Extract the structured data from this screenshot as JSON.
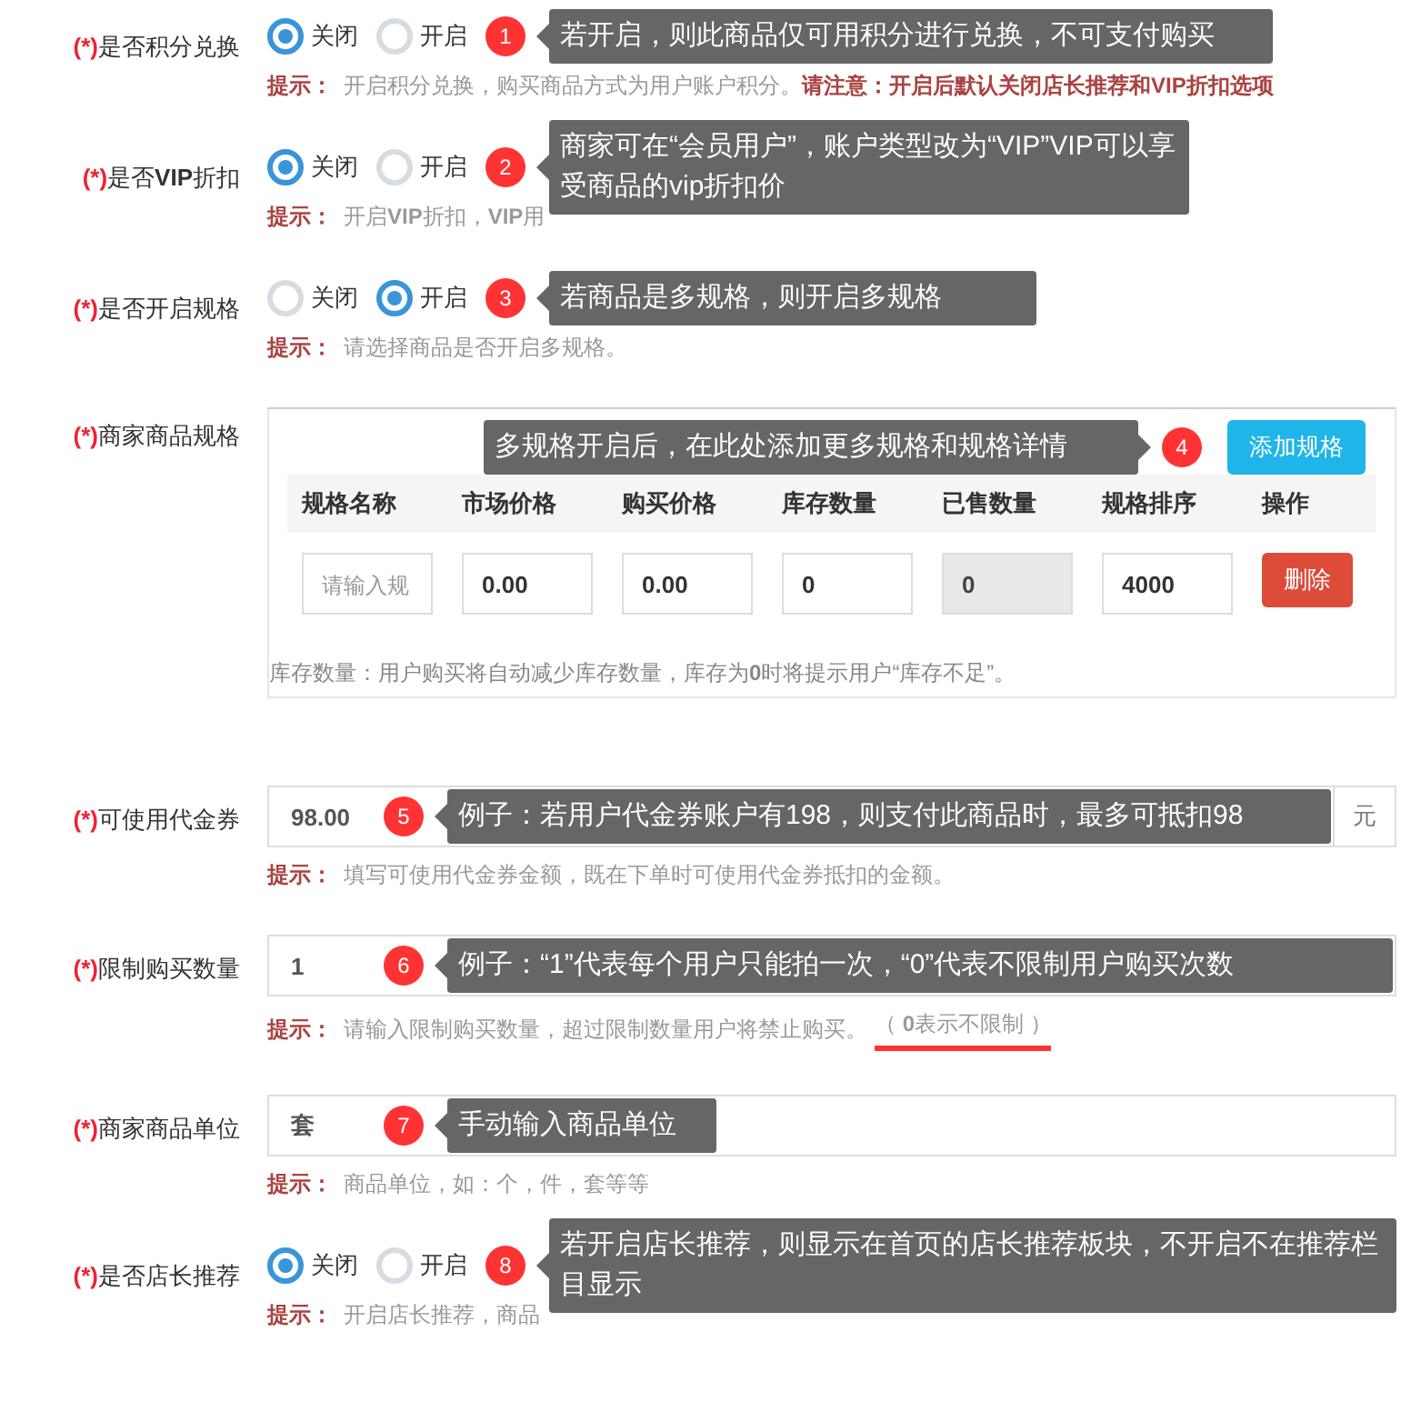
{
  "fields": [
    {
      "kind": "radio",
      "marker": "(*)",
      "label": "是否积分兑换",
      "options": [
        {
          "label": "关闭",
          "selected": true
        },
        {
          "label": "开启",
          "selected": false
        }
      ],
      "callout": {
        "number": "1",
        "text": "若开启，则此商品仅可用积分进行兑换，不可支付购买",
        "badge_first": true
      },
      "hint": {
        "prefix": "提示：",
        "text": "开启积分兑换，购买商品方式为用户账户积分。",
        "warning": "请注意：开启后默认关闭店长推荐和VIP折扣选项"
      }
    },
    {
      "kind": "radio",
      "marker": "(*)",
      "label": "是否**VIP**折扣",
      "options": [
        {
          "label": "关闭",
          "selected": true
        },
        {
          "label": "开启",
          "selected": false
        }
      ],
      "callout": {
        "number": "2",
        "text": "商家可在“会员用户”，账户类型改为“VIP”VIP可以享受商品的vip折扣价",
        "badge_first": true
      },
      "hint": {
        "prefix": "提示：",
        "text": "开启**VIP**折扣，**VIP**用"
      }
    },
    {
      "kind": "radio",
      "marker": "(*)",
      "label": "是否开启规格",
      "options": [
        {
          "label": "关闭",
          "selected": false
        },
        {
          "label": "开启",
          "selected": true
        }
      ],
      "callout": {
        "number": "3",
        "text": "若商品是多规格，则开启多规格",
        "badge_first": true
      },
      "hint": {
        "prefix": "提示：",
        "text": "请选择商品是否开启多规格。"
      }
    },
    {
      "kind": "spec_table",
      "marker": "(*)",
      "label": "商家商品规格",
      "add_button": "添加规格",
      "callout": {
        "number": "4",
        "text": "多规格开启后，在此处添加更多规格和规格详情",
        "badge_first": false
      },
      "columns": [
        "规格名称",
        "市场价格",
        "购买价格",
        "库存数量",
        "已售数量",
        "规格排序",
        "操作"
      ],
      "rows": [
        {
          "cells": [
            {
              "placeholder": "请输入规",
              "disabled": false
            },
            {
              "value": "0.00",
              "disabled": false
            },
            {
              "value": "0.00",
              "disabled": false
            },
            {
              "value": "0",
              "disabled": false
            },
            {
              "value": "0",
              "disabled": true
            },
            {
              "value": "4000",
              "disabled": false
            }
          ],
          "action": "删除"
        }
      ],
      "note": "库存数量：用户购买将自动减少库存数量，库存为**0**时将提示用户“库存不足”。"
    },
    {
      "kind": "input",
      "marker": "(*)",
      "label": "可使用代金券",
      "value": "98.00",
      "addon": "元",
      "callout": {
        "number": "5",
        "text": "例子：若用户代金券账户有198，则支付此商品时，最多可抵扣98",
        "badge_first": true
      },
      "hint": {
        "prefix": "提示：",
        "text": "填写可使用代金券金额，既在下单时可使用代金券抵扣的金额。"
      }
    },
    {
      "kind": "input",
      "marker": "(*)",
      "label": "限制购买数量",
      "value": "1",
      "callout": {
        "number": "6",
        "text": "例子：“1”代表每个用户只能拍一次，“0”代表不限制用户购买次数",
        "badge_first": true
      },
      "hint": {
        "prefix": "提示：",
        "text": "请输入限制购买数量，超过限制数量用户将禁止购买。",
        "note": "（ **0**表示不限制 ）",
        "underlined": true
      }
    },
    {
      "kind": "input",
      "marker": "(*)",
      "label": "商家商品单位",
      "value": "套",
      "callout": {
        "number": "7",
        "text": "手动输入商品单位",
        "badge_first": true
      },
      "hint": {
        "prefix": "提示：",
        "text": "商品单位，如：个，件，套等等"
      }
    },
    {
      "kind": "radio",
      "marker": "(*)",
      "label": "是否店长推荐",
      "options": [
        {
          "label": "关闭",
          "selected": true
        },
        {
          "label": "开启",
          "selected": false
        }
      ],
      "callout": {
        "number": "8",
        "text": "若开启店长推荐，则显示在首页的店长推荐板块，不开启不在推荐栏目显示",
        "badge_first": true
      },
      "hint": {
        "prefix": "提示：",
        "text": "开启店长推荐，商品"
      }
    }
  ]
}
